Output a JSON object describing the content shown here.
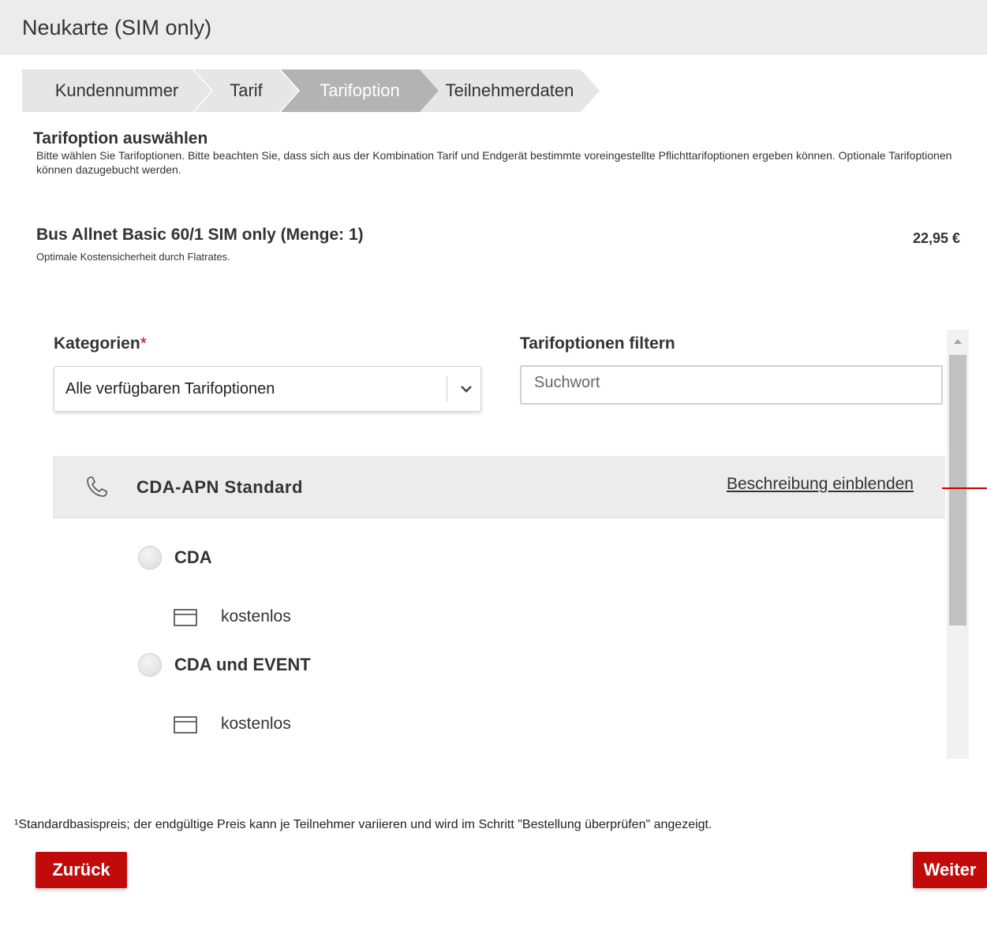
{
  "header": {
    "title": "Neukarte (SIM only)"
  },
  "stepper": {
    "steps": [
      {
        "label": "Kundennummer"
      },
      {
        "label": "Tarif"
      },
      {
        "label": "Tarifoption"
      },
      {
        "label": "Teilnehmerdaten"
      }
    ],
    "active_step": "Tarifoption"
  },
  "intro": {
    "title": "Tarifoption auswählen",
    "text": "Bitte wählen Sie Tarifoptionen. Bitte beachten Sie, dass sich aus der Kombination Tarif und Endgerät bestimmte voreingestellte Pflichttarifoptionen ergeben können. Optionale Tarifoptionen können dazugebucht werden."
  },
  "tariff": {
    "name": "Bus Allnet Basic 60/1 SIM only (Menge: 1)",
    "description": "Optimale Kostensicherheit durch Flatrates.",
    "price": "22,95 €"
  },
  "categories": {
    "label": "Kategorien",
    "required_mark": "*",
    "selected": "Alle verfügbaren Tarifoptionen"
  },
  "filter": {
    "label": "Tarifoptionen filtern",
    "placeholder": "Suchwort"
  },
  "option_group": {
    "icon": "phone-icon",
    "title": "CDA-APN Standard",
    "description_link": "Beschreibung einblenden",
    "options": [
      {
        "label": "CDA",
        "price": "kostenlos",
        "selected": false
      },
      {
        "label": "CDA und EVENT",
        "price": "kostenlos",
        "selected": false
      }
    ]
  },
  "footnote": "¹Standardbasispreis; der endgültige Preis kann je Teilnehmer variieren und wird im Schritt \"Bestellung überprüfen\" angezeigt.",
  "buttons": {
    "back": "Zurück",
    "next": "Weiter"
  },
  "colors": {
    "accent": "#c10a0a",
    "header_bg": "#ececec",
    "step_active": "#b3b3b3"
  }
}
